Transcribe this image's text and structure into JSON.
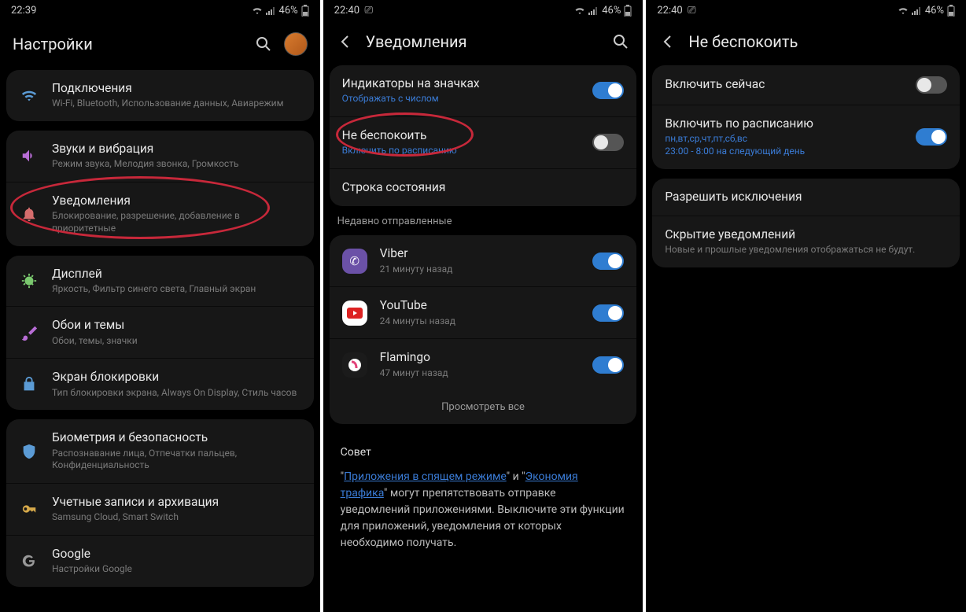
{
  "screens": [
    {
      "time": "22:39",
      "battery": "46%",
      "title": "Настройки",
      "has_back": false,
      "has_search": true,
      "has_avatar": true,
      "groups": [
        {
          "rows": [
            {
              "icon": "wifi",
              "title": "Подключения",
              "sub": "Wi-Fi, Bluetooth, Использование данных, Авиарежим"
            }
          ]
        },
        {
          "rows": [
            {
              "icon": "speaker",
              "title": "Звуки и вибрация",
              "sub": "Режим звука, Мелодия звонка, Громкость"
            },
            {
              "icon": "bell",
              "title": "Уведомления",
              "sub": "Блокирование, разрешение, добавление в приоритетные",
              "annot": true
            }
          ]
        },
        {
          "rows": [
            {
              "icon": "sun",
              "title": "Дисплей",
              "sub": "Яркость, Фильтр синего света, Главный экран"
            },
            {
              "icon": "brush",
              "title": "Обои и темы",
              "sub": "Обои, темы, значки"
            },
            {
              "icon": "lock",
              "title": "Экран блокировки",
              "sub": "Тип блокировки экрана, Always On Display, Стиль часов"
            }
          ]
        },
        {
          "rows": [
            {
              "icon": "shield",
              "title": "Биометрия и безопасность",
              "sub": "Распознавание лица, Отпечатки пальцев, Конфиденциальность"
            },
            {
              "icon": "key",
              "title": "Учетные записи и архивация",
              "sub": "Samsung Cloud, Smart Switch"
            },
            {
              "icon": "google",
              "title": "Google",
              "sub": "Настройки Google"
            }
          ]
        }
      ]
    },
    {
      "time": "22:40",
      "battery": "46%",
      "title": "Уведомления",
      "has_back": true,
      "has_search": true,
      "groups": [
        {
          "rows": [
            {
              "title": "Индикаторы на значках",
              "sub": "Отображать с числом",
              "sub_blue": true,
              "toggle": "on"
            },
            {
              "title": "Не беспокоить",
              "sub": "Включить по расписанию",
              "sub_blue": true,
              "toggle": "off",
              "annot": true
            },
            {
              "title": "Строка состояния"
            }
          ]
        },
        {
          "label": "Недавно отправленные",
          "rows": [
            {
              "app": "viber",
              "title": "Viber",
              "sub": "21 минуту назад",
              "toggle": "on"
            },
            {
              "app": "youtube",
              "title": "YouTube",
              "sub": "24 минуты назад",
              "toggle": "on"
            },
            {
              "app": "flamingo",
              "title": "Flamingo",
              "sub": "47 минут назад",
              "toggle": "on"
            }
          ],
          "view_all": "Просмотреть все"
        }
      ],
      "tip": {
        "heading": "Совет",
        "link1": "Приложения в спящем режиме",
        "mid1": "\" и \"",
        "link2": "Экономия трафика",
        "rest": "\" могут препятствовать отправке уведомлений приложениями. Выключите эти функции для приложений, уведомления от которых необходимо получать."
      }
    },
    {
      "time": "22:40",
      "battery": "46%",
      "title": "Не беспокоить",
      "has_back": true,
      "groups": [
        {
          "rows": [
            {
              "title": "Включить сейчас",
              "toggle": "off"
            },
            {
              "title": "Включить по расписанию",
              "sub": "пн,вт,ср,чт,пт,сб,вс\n23:00 - 8:00 на следующий день",
              "sub_blue": true,
              "toggle": "on"
            }
          ]
        },
        {
          "rows": [
            {
              "title": "Разрешить исключения"
            },
            {
              "title": "Скрытие уведомлений",
              "sub": "Новые и прошлые уведомления отображаться не будут."
            }
          ]
        }
      ]
    }
  ]
}
